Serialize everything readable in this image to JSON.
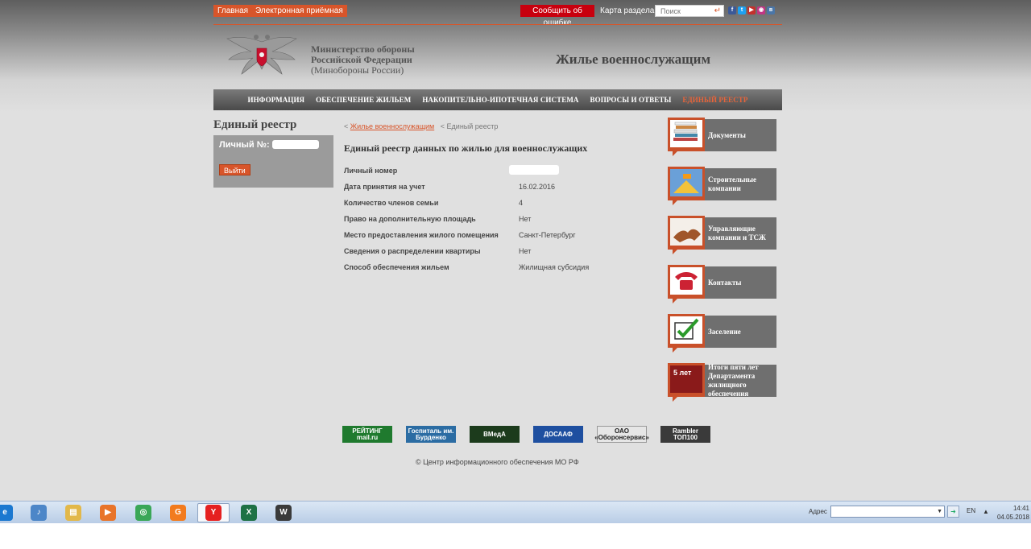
{
  "topbar": {
    "links": [
      "Главная",
      "Электронная приёмная"
    ],
    "report": "Сообщить об ошибке",
    "sitemap": "Карта раздела",
    "search_placeholder": "Поиск",
    "socials": [
      {
        "icon": "facebook-icon",
        "glyph": "f",
        "color": "#3b5998"
      },
      {
        "icon": "twitter-icon",
        "glyph": "t",
        "color": "#1da1f2"
      },
      {
        "icon": "youtube-icon",
        "glyph": "▶",
        "color": "#c4302b"
      },
      {
        "icon": "instagram-icon",
        "glyph": "◉",
        "color": "#c13584"
      },
      {
        "icon": "vk-icon",
        "glyph": "в",
        "color": "#4a76a8"
      }
    ]
  },
  "header": {
    "ministry_line1": "Министерство обороны",
    "ministry_line2": "Российской Федерации",
    "ministry_line3": "(Минобороны России)",
    "site_title": "Жилье военнослужащим"
  },
  "nav": [
    {
      "label": "ИНФОРМАЦИЯ",
      "active": false
    },
    {
      "label": "ОБЕСПЕЧЕНИЕ ЖИЛЬЕМ",
      "active": false
    },
    {
      "label": "НАКОПИТЕЛЬНО-ИПОТЕЧНАЯ СИСТЕМА",
      "active": false
    },
    {
      "label": "ВОПРОСЫ И ОТВЕТЫ",
      "active": false
    },
    {
      "label": "ЕДИНЫЙ РЕЕСТР",
      "active": true
    }
  ],
  "left": {
    "title": "Единый реестр",
    "account_label": "Личный №:",
    "logout": "Выйти"
  },
  "breadcrumb": {
    "sep": "<",
    "link": "Жилье военнослужащим",
    "current": "Единый реестр"
  },
  "main": {
    "title": "Единый реестр данных по жилью для военнослужащих",
    "rows": [
      {
        "key": "Личный номер",
        "value": ""
      },
      {
        "key": "Дата принятия на учет",
        "value": "16.02.2016"
      },
      {
        "key": "Количество членов семьи",
        "value": "4"
      },
      {
        "key": "Право на дополнительную площадь",
        "value": "Нет"
      },
      {
        "key": "Место предоставления жилого помещения",
        "value": "Санкт-Петербург"
      },
      {
        "key": "Сведения о распределении квартиры",
        "value": "Нет"
      },
      {
        "key": "Способ обеспечения жильем",
        "value": "Жилищная субсидия"
      }
    ]
  },
  "tiles": [
    {
      "label": "Документы",
      "icon": "documents-icon"
    },
    {
      "label": "Строительные компании",
      "icon": "construction-icon"
    },
    {
      "label": "Управляющие компании и ТСЖ",
      "icon": "handshake-icon"
    },
    {
      "label": "Контакты",
      "icon": "phone-icon"
    },
    {
      "label": "Заселение",
      "icon": "checkmark-icon"
    },
    {
      "label": "Итоги пяти лет Департамента жилищного обеспечения",
      "icon": "five-years-icon",
      "thumb_text": "5 лет"
    }
  ],
  "banners": [
    {
      "text": "РЕЙТИНГ mail.ru",
      "bg": "#1f7a2e"
    },
    {
      "text": "Госпиталь им. Бурденко",
      "bg": "#2b6ca3"
    },
    {
      "text": "ВМедА",
      "bg": "#1c3b1c"
    },
    {
      "text": "ДОСААФ",
      "bg": "#1e4fa0"
    },
    {
      "text": "ОАО «Оборонсервис»",
      "bg": "#e6e6e6"
    },
    {
      "text": "Rambler ТОП100",
      "bg": "#3a3a3a"
    }
  ],
  "footer": "© Центр информационного обеспечения МО РФ",
  "taskbar": {
    "apps": [
      {
        "icon": "ie-icon",
        "glyph": "e",
        "color": "#1b78d0"
      },
      {
        "icon": "volume-icon",
        "glyph": "♪",
        "color": "#4c86c8"
      },
      {
        "icon": "folder-icon",
        "glyph": "▤",
        "color": "#e2b84a"
      },
      {
        "icon": "media-player-icon",
        "glyph": "▶",
        "color": "#e8742a"
      },
      {
        "icon": "chrome-icon",
        "glyph": "◎",
        "color": "#3aa757"
      },
      {
        "icon": "foxit-icon",
        "glyph": "G",
        "color": "#f27b1e"
      },
      {
        "icon": "yandex-browser-icon",
        "glyph": "Y",
        "color": "#e52020"
      },
      {
        "icon": "excel-icon",
        "glyph": "X",
        "color": "#1e7145"
      },
      {
        "icon": "world-of-tanks-icon",
        "glyph": "W",
        "color": "#3a3a3a"
      }
    ],
    "address_label": "Адрес",
    "lang": "EN",
    "time": "14:41",
    "date": "04.05.2018"
  }
}
